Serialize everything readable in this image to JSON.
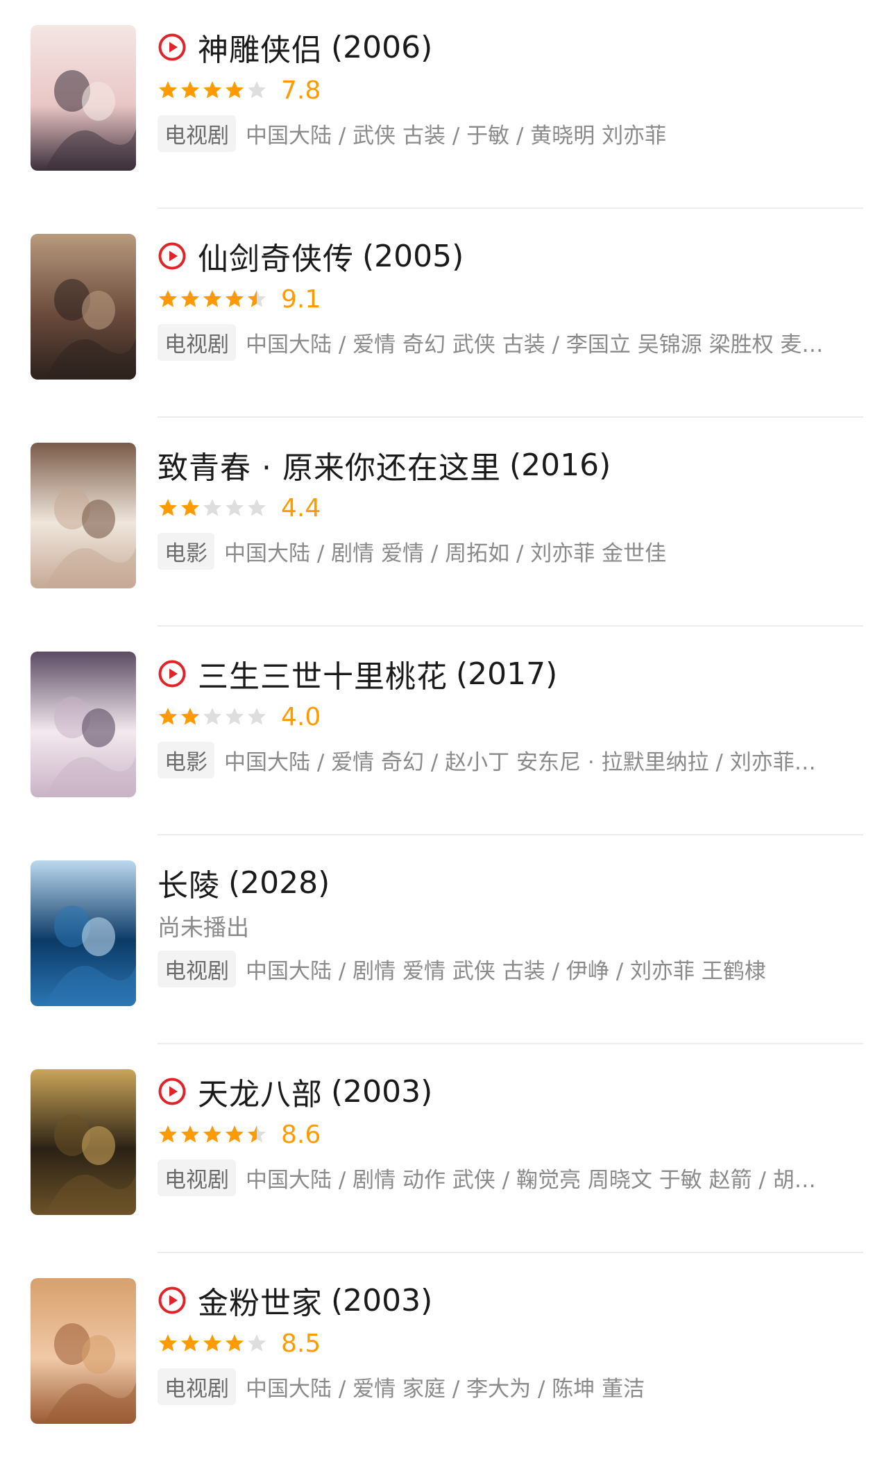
{
  "colors": {
    "accent_red": "#e0242a",
    "star_orange": "#ff9b00",
    "star_empty": "#dedede"
  },
  "items": [
    {
      "title": "神雕侠侣",
      "year": "(2006)",
      "playable": true,
      "score": "7.8",
      "stars": 4,
      "status": "",
      "type": "电视剧",
      "meta": "中国大陆 / 武侠 古装 / 于敏 / 黄晓明 刘亦菲"
    },
    {
      "title": "仙剑奇侠传",
      "year": "(2005)",
      "playable": true,
      "score": "9.1",
      "stars": 4.5,
      "status": "",
      "type": "电视剧",
      "meta": "中国大陆 / 爱情 奇幻 武侠 古装 / 李国立 吴锦源 梁胜权 麦…"
    },
    {
      "title": "致青春 · 原来你还在这里",
      "year": "(2016)",
      "playable": false,
      "score": "4.4",
      "stars": 2,
      "status": "",
      "type": "电影",
      "meta": "中国大陆 / 剧情 爱情 / 周拓如 / 刘亦菲 金世佳"
    },
    {
      "title": "三生三世十里桃花",
      "year": "(2017)",
      "playable": true,
      "score": "4.0",
      "stars": 2,
      "status": "",
      "type": "电影",
      "meta": "中国大陆 / 爱情 奇幻 / 赵小丁 安东尼 · 拉默里纳拉 / 刘亦菲…"
    },
    {
      "title": "长陵",
      "year": "(2028)",
      "playable": false,
      "score": "",
      "stars": 0,
      "status": "尚未播出",
      "type": "电视剧",
      "meta": "中国大陆 / 剧情 爱情 武侠 古装 / 伊峥 / 刘亦菲 王鹤棣"
    },
    {
      "title": "天龙八部",
      "year": "(2003)",
      "playable": true,
      "score": "8.6",
      "stars": 4.5,
      "status": "",
      "type": "电视剧",
      "meta": "中国大陆 / 剧情 动作 武侠 / 鞠觉亮 周晓文 于敏 赵箭 / 胡…"
    },
    {
      "title": "金粉世家",
      "year": "(2003)",
      "playable": true,
      "score": "8.5",
      "stars": 4,
      "status": "",
      "type": "电视剧",
      "meta": "中国大陆 / 爱情 家庭 / 李大为 / 陈坤 董洁"
    }
  ]
}
